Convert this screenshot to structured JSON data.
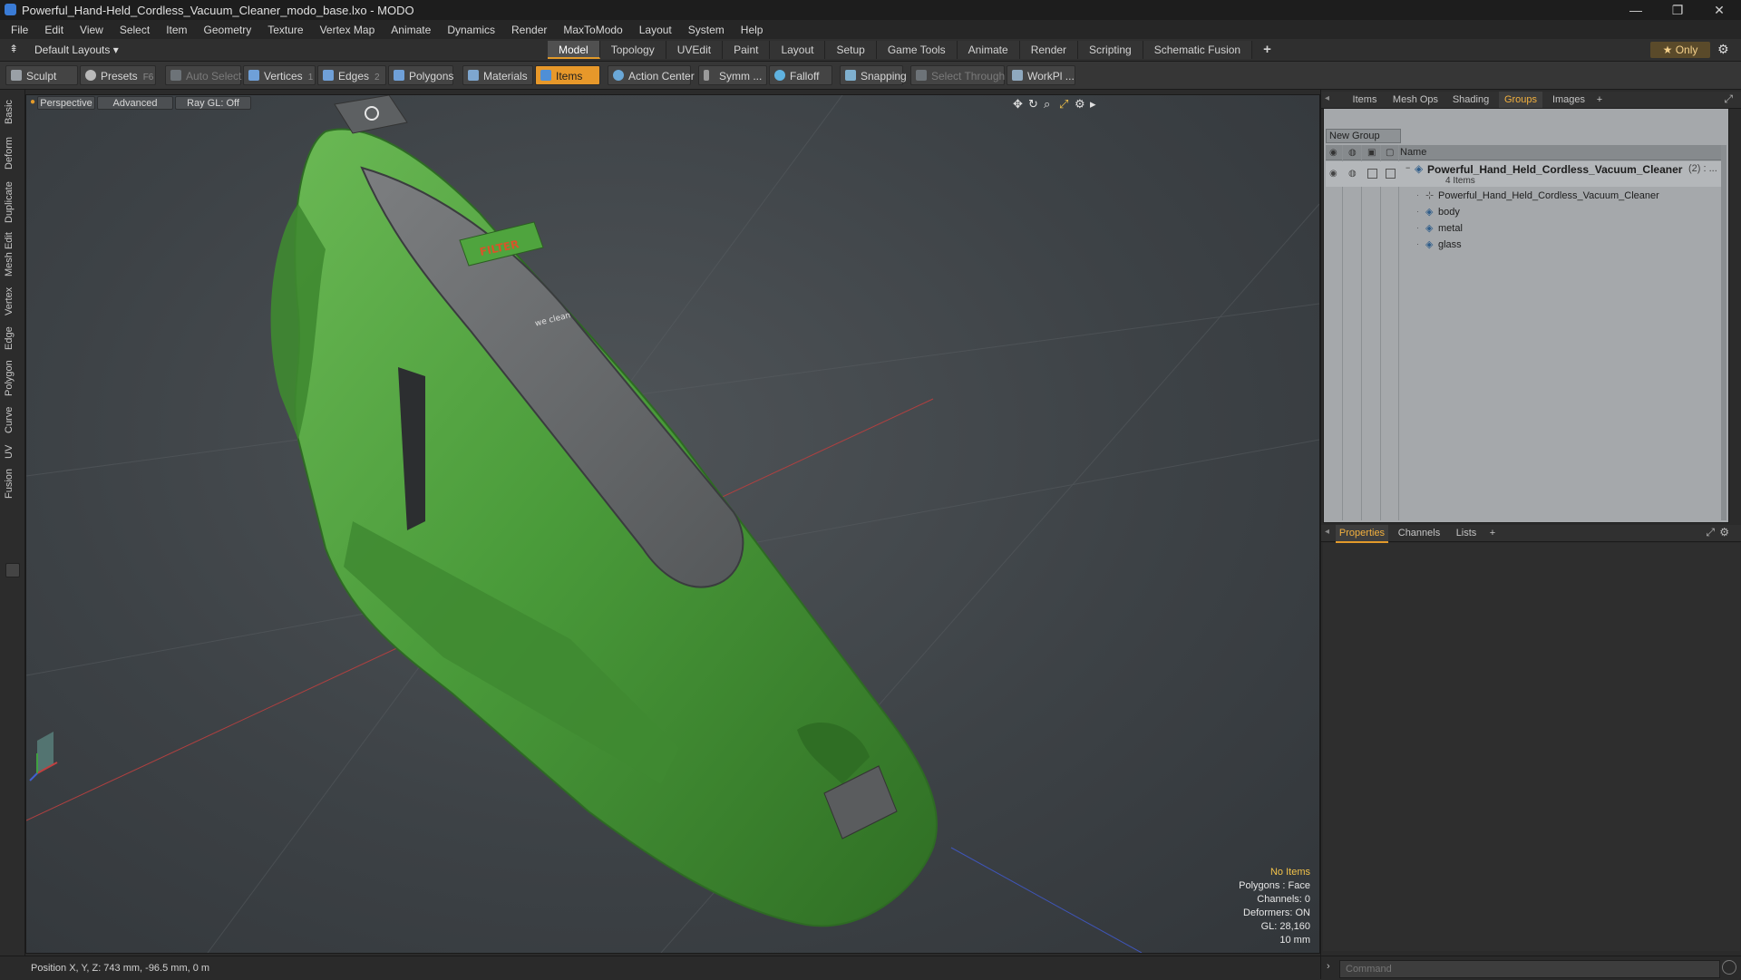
{
  "window": {
    "title": "Powerful_Hand-Held_Cordless_Vacuum_Cleaner_modo_base.lxo - MODO",
    "minimize": "—",
    "restore": "❐",
    "close": "✕"
  },
  "menu": [
    "File",
    "Edit",
    "View",
    "Select",
    "Item",
    "Geometry",
    "Texture",
    "Vertex Map",
    "Animate",
    "Dynamics",
    "Render",
    "MaxToModo",
    "Layout",
    "System",
    "Help"
  ],
  "layout_selector": "Default Layouts ▾",
  "mode_tabs": [
    {
      "label": "Model",
      "active": true
    },
    {
      "label": "Topology",
      "active": false
    },
    {
      "label": "UVEdit",
      "active": false
    },
    {
      "label": "Paint",
      "active": false
    },
    {
      "label": "Layout",
      "active": false
    },
    {
      "label": "Setup",
      "active": false
    },
    {
      "label": "Game Tools",
      "active": false
    },
    {
      "label": "Animate",
      "active": false
    },
    {
      "label": "Render",
      "active": false
    },
    {
      "label": "Scripting",
      "active": false
    },
    {
      "label": "Schematic Fusion",
      "active": false
    }
  ],
  "add_tab": "+",
  "only_button": "★  Only",
  "settings_icon": "⚙",
  "toolbar": {
    "sculpt": "Sculpt",
    "presets": "Presets",
    "presets_key": "F6",
    "auto_select": "Auto Select",
    "vertices": "Vertices",
    "vertices_key": "1",
    "edges": "Edges",
    "edges_key": "2",
    "polygons": "Polygons",
    "materials": "Materials",
    "items": "Items",
    "action_center": "Action Center",
    "symmetry": "Symm ...",
    "falloff": "Falloff",
    "snapping": "Snapping",
    "select_through": "Select Through",
    "workplane": "WorkPl ..."
  },
  "left_tabs": [
    "Basic",
    "Deform",
    "Duplicate",
    "Mesh Edit",
    "Vertex",
    "Edge",
    "Polygon",
    "Curve",
    "UV",
    "Fusion"
  ],
  "viewport": {
    "perspective": "Perspective",
    "advanced": "Advanced",
    "raygl": "Ray GL: Off",
    "decal_filter": "FILTER",
    "decal_brand": "we clean",
    "info": {
      "no_items": "No Items",
      "polygons": "Polygons : Face",
      "channels": "Channels: 0",
      "deformers": "Deformers: ON",
      "gl": "GL: 28,160",
      "grid": "10 mm"
    },
    "colors": {
      "body": "#4a9b3a",
      "panel": "#6a6c6e",
      "dark": "#3d3f40"
    }
  },
  "status": {
    "position": "Position X, Y, Z:   743 mm, -96.5 mm, 0 m"
  },
  "right_panel": {
    "top_tabs": [
      {
        "label": "Items",
        "active": false
      },
      {
        "label": "Mesh Ops",
        "active": false
      },
      {
        "label": "Shading",
        "active": false
      },
      {
        "label": "Groups",
        "active": true
      },
      {
        "label": "Images",
        "active": false
      }
    ],
    "add": "+",
    "new_group": "New Group",
    "column_name": "Name",
    "group": {
      "name": "Powerful_Hand_Held_Cordless_Vacuum_Cleaner",
      "count": "(2) : ...",
      "sub": "4 Items"
    },
    "items": [
      {
        "label": "Powerful_Hand_Held_Cordless_Vacuum_Cleaner",
        "kind": "locator"
      },
      {
        "label": "body",
        "kind": "mesh"
      },
      {
        "label": "metal",
        "kind": "mesh"
      },
      {
        "label": "glass",
        "kind": "mesh"
      }
    ],
    "bottom_tabs": [
      {
        "label": "Properties",
        "active": true
      },
      {
        "label": "Channels",
        "active": false
      },
      {
        "label": "Lists",
        "active": false
      }
    ],
    "command_placeholder": "Command"
  }
}
